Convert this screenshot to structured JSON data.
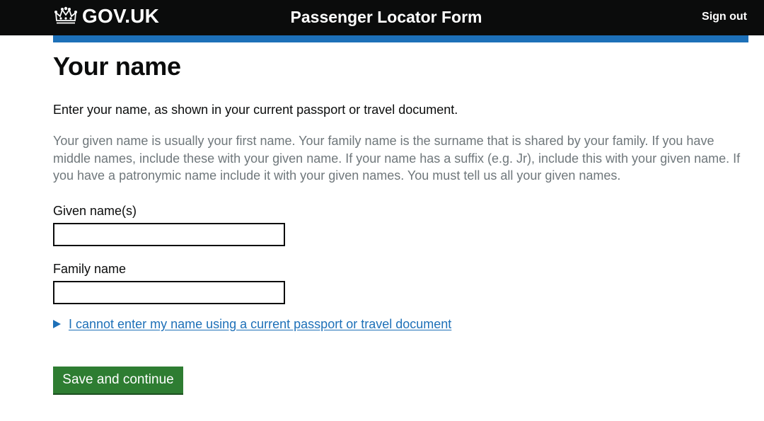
{
  "header": {
    "logo_text": "GOV.UK",
    "service_name": "Passenger Locator Form",
    "sign_out": "Sign out"
  },
  "page": {
    "title": "Your name",
    "lead": "Enter your name, as shown in your current passport or travel document.",
    "hint": "Your given name is usually your first name. Your family name is the surname that is shared by your family. If you have middle names, include these with your given name. If your name has a suffix (e.g. Jr), include this with your given name. If you have a patronymic name include it with your given names. You must tell us all your given names."
  },
  "form": {
    "given_name_label": "Given name(s)",
    "given_name_value": "",
    "family_name_label": "Family name",
    "family_name_value": "",
    "details_summary": "I cannot enter my name using a current passport or travel document",
    "submit_label": "Save and continue"
  },
  "colors": {
    "header_bg": "#0b0c0c",
    "accent_blue": "#1d70b8",
    "button_green": "#2e7d32",
    "hint_grey": "#6f777b"
  }
}
